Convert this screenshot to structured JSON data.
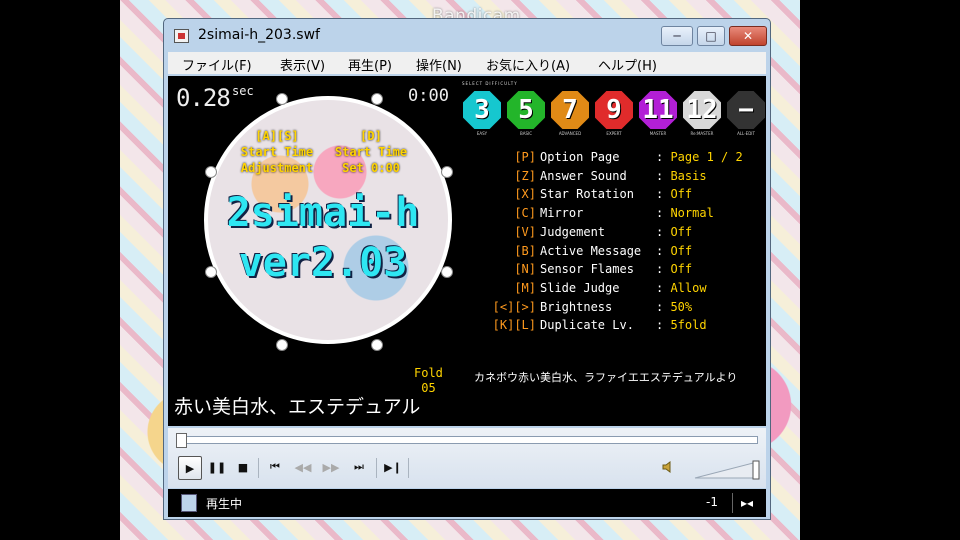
{
  "overlay": {
    "watermark": "Bandicam"
  },
  "window": {
    "title": "2simai-h_203.swf",
    "controls": {
      "minimize": "─",
      "maximize": "□",
      "close": "✕"
    }
  },
  "menu": [
    "ファイル(F)",
    "表示(V)",
    "再生(P)",
    "操作(N)",
    "お気に入り(A)",
    "ヘルプ(H)"
  ],
  "game": {
    "timer_value": "0.28",
    "timer_unit": "sec",
    "clock": "0:00",
    "left_hint": [
      "[A][S]",
      "Start Time",
      "Adjustment"
    ],
    "right_hint": [
      "[D]",
      "Start Time",
      "Set 0:00"
    ],
    "title_line1": "2simai-h",
    "title_line2": "ver2.03",
    "fold_label": "Fold",
    "fold_value": "05",
    "song_title": "赤い美白水、エステデュアル",
    "credit": "カネボウ赤い美白水、ラファイエエステデュアルより",
    "difficulty_header": "SELECT DIFFICULTY",
    "difficulties": [
      {
        "label": "3",
        "color": "#16c7cf",
        "sub": "EASY"
      },
      {
        "label": "5",
        "color": "#23b52a",
        "sub": "BASIC"
      },
      {
        "label": "7",
        "color": "#e08a16",
        "sub": "ADVANCED"
      },
      {
        "label": "9",
        "color": "#e02b2b",
        "sub": "EXPERT"
      },
      {
        "label": "11",
        "color": "#b21fd6",
        "sub": "MASTER"
      },
      {
        "label": "12",
        "color": "#d8d8d8",
        "sub": "Re:MASTER"
      },
      {
        "label": "−",
        "color": "#333333",
        "sub": "ALL-EDIT"
      }
    ],
    "options": [
      {
        "key": "[P]",
        "name": "Option Page",
        "value": "Page 1 / 2"
      },
      {
        "key": "[Z]",
        "name": "Answer Sound",
        "value": "Basis"
      },
      {
        "key": "[X]",
        "name": "Star Rotation",
        "value": "Off"
      },
      {
        "key": "[C]",
        "name": "Mirror",
        "value": "Normal"
      },
      {
        "key": "[V]",
        "name": "Judgement",
        "value": "Off"
      },
      {
        "key": "[B]",
        "name": "Active Message",
        "value": "Off"
      },
      {
        "key": "[N]",
        "name": "Sensor Flames",
        "value": "Off"
      },
      {
        "key": "[M]",
        "name": "Slide Judge",
        "value": "Allow"
      },
      {
        "key": "[<][>]",
        "name": "Brightness",
        "value": "50%"
      },
      {
        "key": "[K][L]",
        "name": "Duplicate Lv.",
        "value": "5fold"
      }
    ]
  },
  "player": {
    "status": "再生中",
    "counter": "-1",
    "progress": 0.0
  }
}
